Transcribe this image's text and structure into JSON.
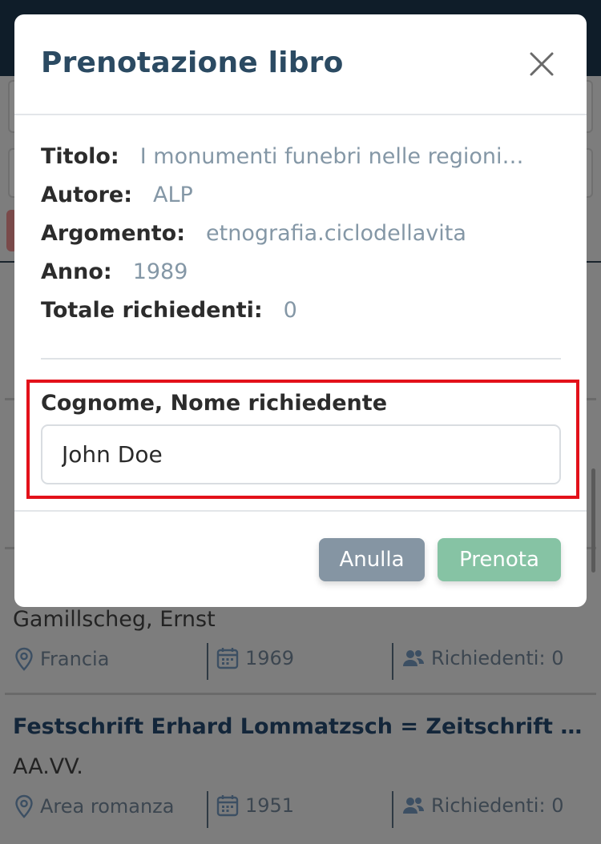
{
  "modal": {
    "title": "Prenotazione libro",
    "fields": [
      {
        "label": "Titolo:",
        "value": "I monumenti funebri nelle regioni…"
      },
      {
        "label": "Autore:",
        "value": "ALP"
      },
      {
        "label": "Argomento:",
        "value": "etnografia.ciclodellavita"
      },
      {
        "label": "Anno:",
        "value": "1989"
      },
      {
        "label": "Totale richiedenti:",
        "value": "0"
      }
    ],
    "requester_label": "Cognome, Nome richiedente",
    "requester_value": "John Doe",
    "cancel_label": "Anulla",
    "book_label": "Prenota"
  },
  "background": {
    "items": [
      {
        "author": "Gamillscheg, Ernst",
        "place": "Francia",
        "year": "1969",
        "requests": "Richiedenti: 0"
      },
      {
        "title": "Festschrift Erhard Lommatzsch = Zeitschrift für romanische Philologie",
        "author": "AA.VV.",
        "place": "Area romanza",
        "year": "1951",
        "requests": "Richiedenti: 0"
      }
    ]
  },
  "colors": {
    "accent_highlight": "#e3111a",
    "title_color": "#2b4a62",
    "cancel_button": "#8595a3",
    "book_button": "#86c3a4"
  },
  "icons": {
    "close": "close-icon",
    "place": "map-pin-icon",
    "year": "calendar-icon",
    "requests": "users-icon"
  }
}
